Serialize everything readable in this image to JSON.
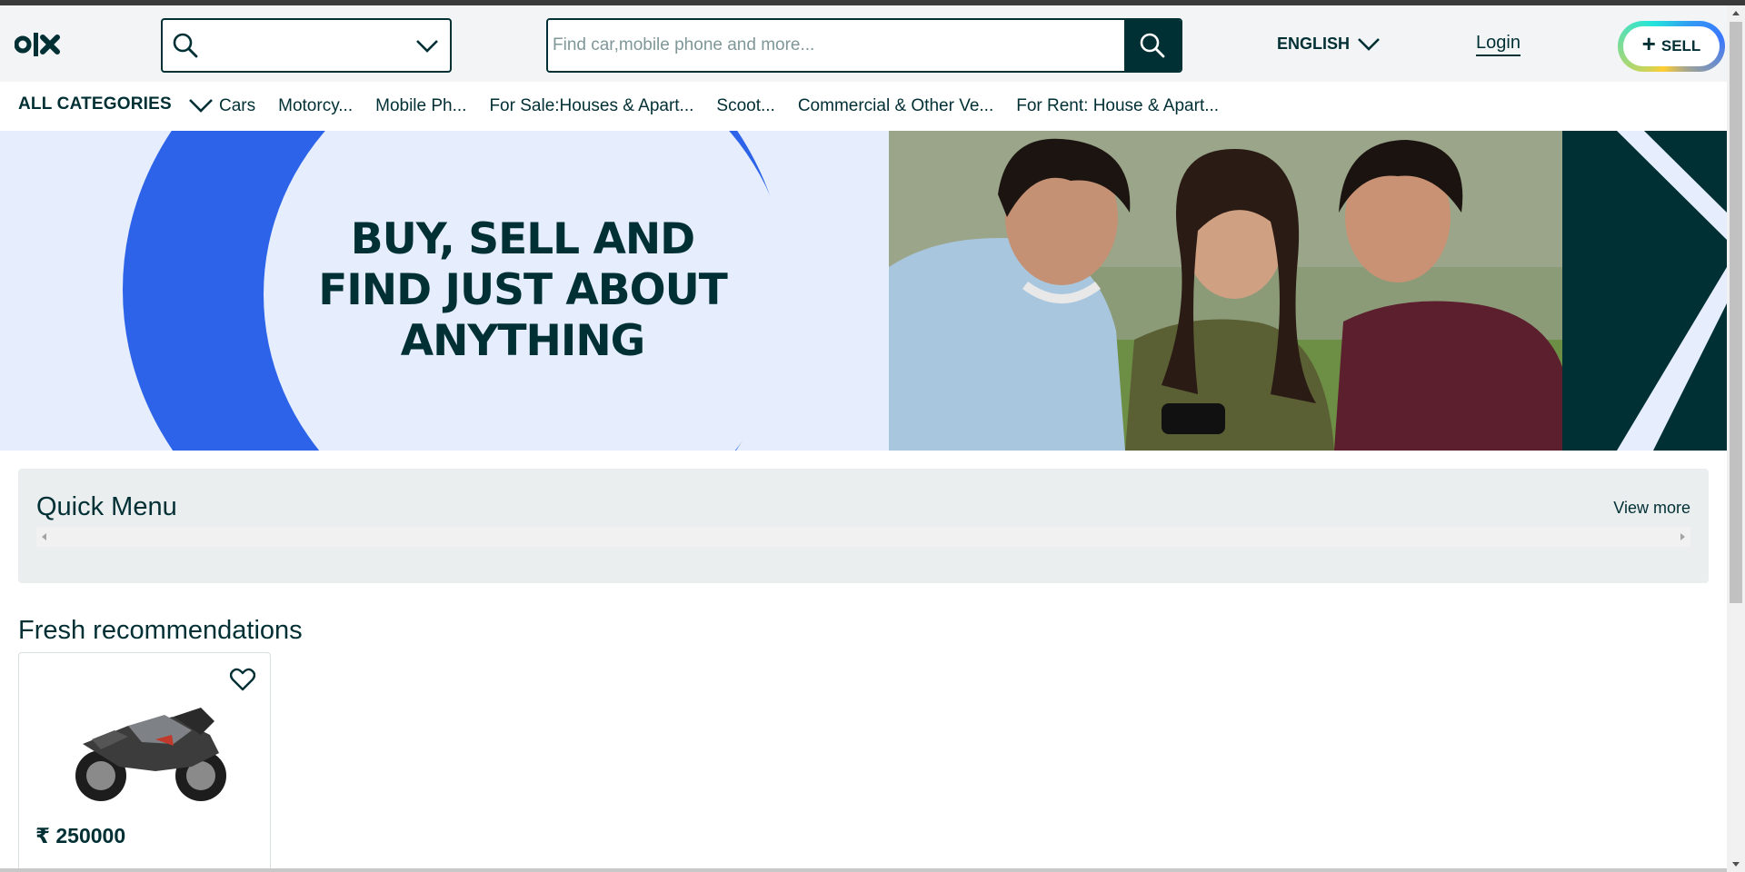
{
  "brand": {
    "logo_text": "olx",
    "primary_color": "#002f34",
    "accent_blue": "#2c63e8"
  },
  "header": {
    "location_icon": "search-icon",
    "search": {
      "placeholder": "Find car,mobile phone and more...",
      "value": ""
    },
    "language": "ENGLISH",
    "login": "Login",
    "sell": "SELL"
  },
  "categories": {
    "all_label": "ALL CATEGORIES",
    "items": [
      "Cars",
      "Motorcy...",
      "Mobile Ph...",
      "For Sale:Houses & Apart...",
      "Scoot...",
      "Commercial & Other Ve...",
      "For Rent: House & Apart..."
    ]
  },
  "banner": {
    "headline_lines": [
      "BUY, SELL AND",
      "FIND JUST ABOUT",
      "ANYTHING"
    ]
  },
  "quick_menu": {
    "title": "Quick Menu",
    "view_more": "View more"
  },
  "fresh": {
    "title": "Fresh recommendations",
    "cards": [
      {
        "price": "₹ 250000",
        "image": "motorcycle"
      }
    ]
  }
}
